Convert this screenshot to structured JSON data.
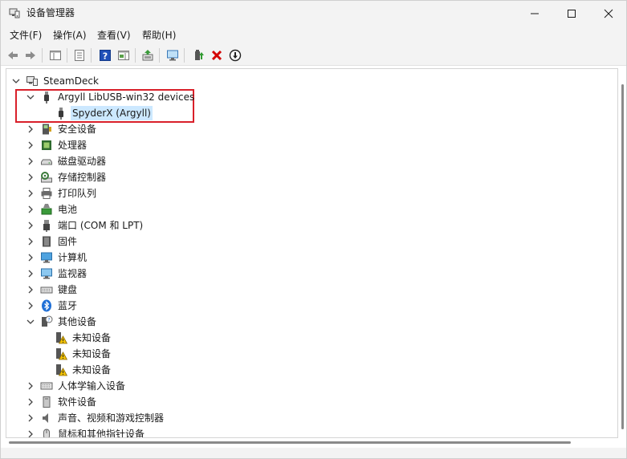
{
  "window": {
    "title": "设备管理器",
    "app_icon": "device-manager-icon"
  },
  "menu": {
    "items": [
      {
        "label": "文件(F)"
      },
      {
        "label": "操作(A)"
      },
      {
        "label": "查看(V)"
      },
      {
        "label": "帮助(H)"
      }
    ]
  },
  "toolbar": {
    "buttons": [
      {
        "icon": "back-arrow-icon"
      },
      {
        "icon": "forward-arrow-icon"
      },
      {
        "icon": "show-hide-console-tree-icon"
      },
      {
        "icon": "properties-icon"
      },
      {
        "icon": "help-icon"
      },
      {
        "icon": "show-hide-action-pane-icon"
      },
      {
        "icon": "update-driver-icon"
      },
      {
        "icon": "scan-hardware-changes-icon"
      },
      {
        "icon": "enable-device-icon"
      },
      {
        "icon": "uninstall-device-icon"
      },
      {
        "icon": "disable-device-icon"
      }
    ]
  },
  "tree": {
    "root": {
      "label": "SteamDeck",
      "expanded": true
    },
    "nodes": [
      {
        "label": "Argyll LibUSB-win32 devices",
        "icon": "usb-plug-icon",
        "expanded": true,
        "children": [
          {
            "label": "SpyderX (Argyll)",
            "icon": "usb-plug-icon",
            "selected": true
          }
        ]
      },
      {
        "label": "安全设备",
        "icon": "security-device-icon",
        "expanded": false
      },
      {
        "label": "处理器",
        "icon": "processor-icon",
        "expanded": false
      },
      {
        "label": "磁盘驱动器",
        "icon": "disk-drive-icon",
        "expanded": false
      },
      {
        "label": "存储控制器",
        "icon": "storage-controller-icon",
        "expanded": false
      },
      {
        "label": "打印队列",
        "icon": "printer-icon",
        "expanded": false
      },
      {
        "label": "电池",
        "icon": "battery-icon",
        "expanded": false
      },
      {
        "label": "端口 (COM 和 LPT)",
        "icon": "port-icon",
        "expanded": false
      },
      {
        "label": "固件",
        "icon": "firmware-icon",
        "expanded": false
      },
      {
        "label": "计算机",
        "icon": "computer-icon",
        "expanded": false
      },
      {
        "label": "监视器",
        "icon": "monitor-icon",
        "expanded": false
      },
      {
        "label": "键盘",
        "icon": "keyboard-icon",
        "expanded": false
      },
      {
        "label": "蓝牙",
        "icon": "bluetooth-icon",
        "expanded": false
      },
      {
        "label": "其他设备",
        "icon": "other-devices-icon",
        "expanded": true,
        "children": [
          {
            "label": "未知设备",
            "icon": "unknown-device-warning-icon"
          },
          {
            "label": "未知设备",
            "icon": "unknown-device-warning-icon"
          },
          {
            "label": "未知设备",
            "icon": "unknown-device-warning-icon"
          }
        ]
      },
      {
        "label": "人体学输入设备",
        "icon": "hid-icon",
        "expanded": false
      },
      {
        "label": "软件设备",
        "icon": "software-device-icon",
        "expanded": false
      },
      {
        "label": "声音、视频和游戏控制器",
        "icon": "sound-icon",
        "expanded": false
      },
      {
        "label": "鼠标和其他指针设备",
        "icon": "mouse-icon",
        "expanded": false
      }
    ]
  },
  "colors": {
    "selection": "#cce8ff",
    "highlight_border": "#d9202a",
    "accent_blue": "#1f6fd6",
    "uninstall_red": "#d40000",
    "warning_yellow": "#f2c200"
  }
}
